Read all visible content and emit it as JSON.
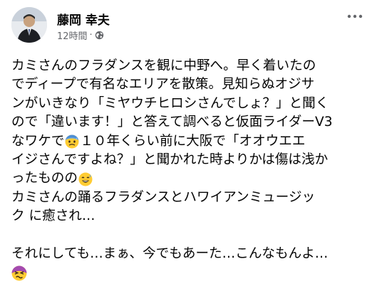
{
  "post": {
    "author": "藤岡 幸夫",
    "timestamp": "12時間",
    "separator": "·",
    "privacy_icon": "globe-icon",
    "more_icon": "more-options-icon",
    "lines": {
      "l1": "カミさんのフラダンスを観に中野へ。早く着いたの",
      "l2": "でディープで有名なエリアを散策。見知らぬオジサ",
      "l3": "ンがいきなり「ミヤウチヒロシさんでしょ？」と聞く",
      "l4": "ので「違います！」と答えて調べると仮面ライダーV3",
      "l5a": "なワケで",
      "l5b": "１０年くらい前に大阪で「オオウエエ",
      "l6": "イジさんですよね？」と聞かれた時よりかは傷は浅か",
      "l7": "ったものの",
      "l8": "カミさんの踊るフラダンスとハワイアンミュージッ",
      "l9": "ク に癒され…",
      "l10": "それにしても…まぁ、今でもあーた…こんなもんよ…"
    },
    "emojis": {
      "e1": "anxious-sweat-emoji",
      "e2": "grinning-sweat-emoji",
      "e3": "dizzy-face-emoji"
    }
  },
  "colors": {
    "text": "#050505",
    "meta": "#65676b",
    "emoji_yellow": "#ffcc33",
    "emoji_blue": "#6ea8e0",
    "emoji_purple": "#a44ab0"
  }
}
